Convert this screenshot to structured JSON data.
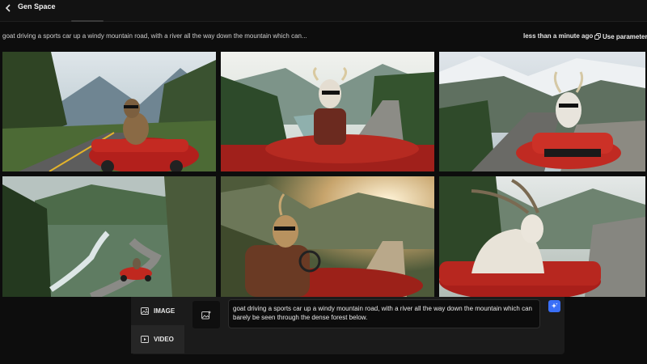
{
  "header": {
    "title": "Gen Space",
    "back_icon": "chevron-left-icon"
  },
  "generation": {
    "prompt_preview": "goat driving a sports car up a windy mountain road, with a river all the way down the mountain which can...",
    "timestamp": "less than a minute ago",
    "use_parameters_label": "Use parameter",
    "use_parameters_icon": "copy-icon"
  },
  "images": [
    {
      "label": "goat-in-red-roadster-forest-road"
    },
    {
      "label": "goat-in-sunglasses-driving-river-valley"
    },
    {
      "label": "goat-in-red-sports-car-mountain-pass"
    },
    {
      "label": "red-car-on-winding-road-by-river"
    },
    {
      "label": "goat-in-leather-jacket-sunset-drive"
    },
    {
      "label": "long-horned-goat-in-red-car"
    }
  ],
  "composer": {
    "modes": [
      {
        "label": "IMAGE",
        "icon": "image-icon"
      },
      {
        "label": "VIDEO",
        "icon": "video-icon"
      }
    ],
    "prompt_value": "goat driving a sports car up a windy mountain road, with a river all the way down the mountain which can barely be seen through the dense forest below.",
    "image_reference_icon": "image-add-icon",
    "enhance_icon": "sparkle-icon"
  },
  "colors": {
    "background": "#0d0d0d",
    "panel": "#1b1b1b",
    "accent": "#3a6ff7",
    "car_red": "#b3201c"
  }
}
